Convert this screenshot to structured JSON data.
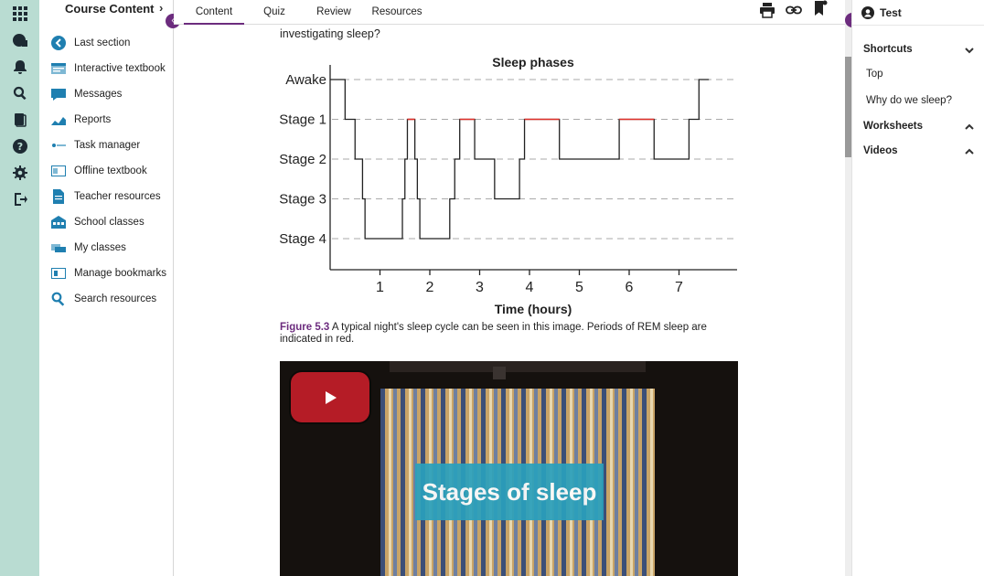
{
  "nav": {
    "title": "Course Content",
    "items": [
      {
        "label": "Last section",
        "icon": "last-section-icon"
      },
      {
        "label": "Interactive textbook",
        "icon": "interactive-textbook-icon"
      },
      {
        "label": "Messages",
        "icon": "messages-icon"
      },
      {
        "label": "Reports",
        "icon": "reports-icon"
      },
      {
        "label": "Task manager",
        "icon": "task-manager-icon"
      },
      {
        "label": "Offline textbook",
        "icon": "offline-textbook-icon"
      },
      {
        "label": "Teacher resources",
        "icon": "teacher-resources-icon"
      },
      {
        "label": "School classes",
        "icon": "school-classes-icon"
      },
      {
        "label": "My classes",
        "icon": "my-classes-icon"
      },
      {
        "label": "Manage bookmarks",
        "icon": "manage-bookmarks-icon"
      },
      {
        "label": "Search resources",
        "icon": "search-resources-icon"
      }
    ]
  },
  "tabs": [
    "Content",
    "Quiz",
    "Review",
    "Resources"
  ],
  "content": {
    "intro": "investigating sleep?",
    "figure_label": "Figure 5.3",
    "caption": " A typical night's sleep cycle can be seen in this image. Periods of REM sleep are indicated in red.",
    "video_title": "Stages of sleep"
  },
  "right": {
    "user": "Test",
    "shortcuts": "Shortcuts",
    "links": [
      "Top",
      "Why do we sleep?"
    ],
    "worksheets": "Worksheets",
    "videos": "Videos"
  },
  "colors": {
    "accent": "#6c2c7e",
    "rail": "#b9dcd2",
    "rem": "#e0302a",
    "video_overlay": "#2aa0bd"
  },
  "chart_data": {
    "type": "line",
    "title": "Sleep phases",
    "xlabel": "Time (hours)",
    "ylabel": "",
    "x_ticks": [
      1,
      2,
      3,
      4,
      5,
      6,
      7
    ],
    "y_categories": [
      "Awake",
      "Stage 1",
      "Stage 2",
      "Stage 3",
      "Stage 4"
    ],
    "xlim": [
      0,
      8
    ],
    "grid": "dashed horizontal",
    "hypnogram": [
      {
        "x": 0.0,
        "stage": 0
      },
      {
        "x": 0.3,
        "stage": 0
      },
      {
        "x": 0.3,
        "stage": 1
      },
      {
        "x": 0.5,
        "stage": 1
      },
      {
        "x": 0.5,
        "stage": 2
      },
      {
        "x": 0.65,
        "stage": 2
      },
      {
        "x": 0.65,
        "stage": 3
      },
      {
        "x": 0.7,
        "stage": 3
      },
      {
        "x": 0.7,
        "stage": 4
      },
      {
        "x": 1.45,
        "stage": 4
      },
      {
        "x": 1.45,
        "stage": 3
      },
      {
        "x": 1.5,
        "stage": 3
      },
      {
        "x": 1.5,
        "stage": 2
      },
      {
        "x": 1.55,
        "stage": 2
      },
      {
        "x": 1.55,
        "stage": 1
      },
      {
        "x": 1.7,
        "stage": 1
      },
      {
        "x": 1.7,
        "stage": 2
      },
      {
        "x": 1.75,
        "stage": 2
      },
      {
        "x": 1.75,
        "stage": 3
      },
      {
        "x": 1.8,
        "stage": 3
      },
      {
        "x": 1.8,
        "stage": 4
      },
      {
        "x": 2.4,
        "stage": 4
      },
      {
        "x": 2.4,
        "stage": 3
      },
      {
        "x": 2.5,
        "stage": 3
      },
      {
        "x": 2.5,
        "stage": 2
      },
      {
        "x": 2.6,
        "stage": 2
      },
      {
        "x": 2.6,
        "stage": 1
      },
      {
        "x": 2.9,
        "stage": 1
      },
      {
        "x": 2.9,
        "stage": 2
      },
      {
        "x": 3.3,
        "stage": 2
      },
      {
        "x": 3.3,
        "stage": 3
      },
      {
        "x": 3.8,
        "stage": 3
      },
      {
        "x": 3.8,
        "stage": 2
      },
      {
        "x": 3.9,
        "stage": 2
      },
      {
        "x": 3.9,
        "stage": 1
      },
      {
        "x": 4.6,
        "stage": 1
      },
      {
        "x": 4.6,
        "stage": 2
      },
      {
        "x": 5.8,
        "stage": 2
      },
      {
        "x": 5.8,
        "stage": 1
      },
      {
        "x": 6.5,
        "stage": 1
      },
      {
        "x": 6.5,
        "stage": 2
      },
      {
        "x": 7.2,
        "stage": 2
      },
      {
        "x": 7.2,
        "stage": 1
      },
      {
        "x": 7.4,
        "stage": 1
      },
      {
        "x": 7.4,
        "stage": 0
      },
      {
        "x": 7.6,
        "stage": 0
      }
    ],
    "rem_periods": [
      {
        "start": 1.55,
        "end": 1.7
      },
      {
        "start": 2.6,
        "end": 2.9
      },
      {
        "start": 3.9,
        "end": 4.6
      },
      {
        "start": 5.8,
        "end": 6.5
      }
    ]
  }
}
